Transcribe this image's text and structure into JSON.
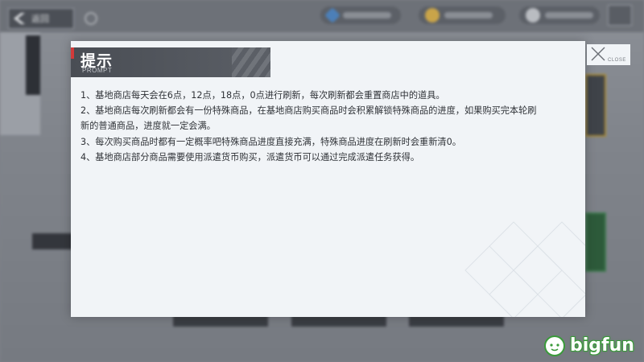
{
  "background": {
    "back_label": "返回"
  },
  "dialog": {
    "title": "提示",
    "subtitle": "PROMPT",
    "lines": [
      "1、基地商店每天会在6点，12点，18点，0点进行刷新，每次刷新都会重置商店中的道具。",
      "2、基地商店每次刷新都会有一份特殊商品，在基地商店购买商品时会积累解锁特殊商品的进度，如果购买完本轮刷",
      "新的普通商品，进度就一定会满。",
      "3、每次购买商品时都有一定概率吧特殊商品进度直接充满，特殊商品进度在刷新时会重新清0。",
      "4、基地商店部分商品需要使用派遣货币购买，派遣货币可以通过完成派遣任务获得。"
    ],
    "close_label": "CLOSE"
  },
  "watermark": {
    "text": "bigfun"
  },
  "colors": {
    "dialog_bg": "#f1f4f7",
    "title_bg": "#494d54",
    "accent_red": "#d23a3a",
    "text": "#2f3237"
  },
  "icons": [
    "back-arrow-icon",
    "info-icon",
    "currency-icon",
    "coin-icon",
    "mail-icon",
    "close-icon"
  ]
}
